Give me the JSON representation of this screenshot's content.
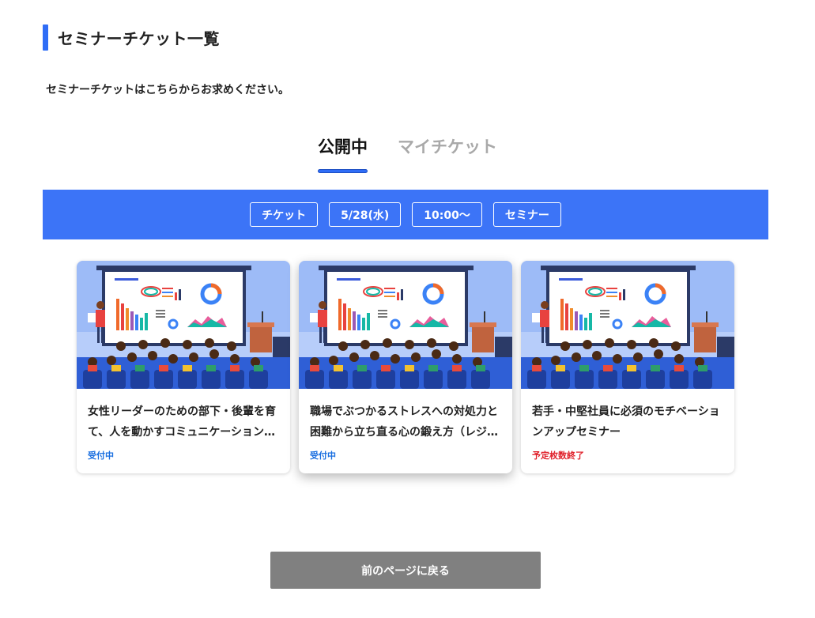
{
  "page": {
    "title": "セミナーチケット一覧",
    "lead": "セミナーチケットはこちらからお求めください。"
  },
  "tabs": [
    {
      "label": "公開中",
      "active": true
    },
    {
      "label": "マイチケット",
      "active": false
    }
  ],
  "filters": [
    "チケット",
    "5/28(水)",
    "10:00〜",
    "セミナー"
  ],
  "cards": [
    {
      "title": "女性リーダーのための部下・後輩を育て、人を動かすコミュニケーションセミナー",
      "status": "受付中",
      "status_color": "#1a6fe0"
    },
    {
      "title": "職場でぶつかるストレスへの対処力と困難から立ち直る心の鍛え方（レジリエンス）",
      "status": "受付中",
      "status_color": "#1a6fe0"
    },
    {
      "title": "若手・中堅社員に必須のモチベーションアップセミナー",
      "status": "予定枚数終了",
      "status_color": "#e0202a"
    }
  ],
  "back_button": "前のページに戻る",
  "colors": {
    "accent": "#3c74f7",
    "open": "#1a6fe0",
    "closed": "#e0202a",
    "button": "#808080"
  }
}
